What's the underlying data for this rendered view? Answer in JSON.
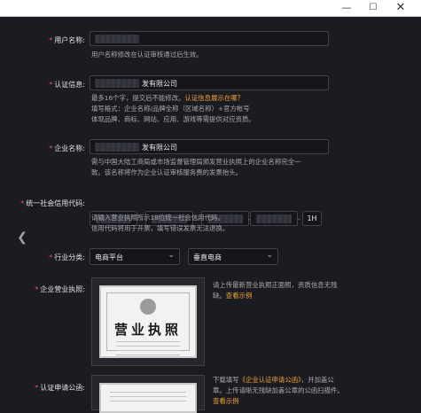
{
  "window": {
    "minimize_icon": "minimize-icon",
    "maximize_icon": "maximize-icon",
    "close_icon": "close-icon"
  },
  "form": {
    "username": {
      "label": "用户名称:",
      "hint": "用户名称修改在认证审核通过后生效。"
    },
    "cert_info": {
      "label": "认证信息:",
      "value_suffix": "发有限公司",
      "hint_line1": "最多16个字，提交后不能修改。",
      "hint_link": "认证信息展示在哪？",
      "hint_line2": "填写格式：企业名称/品牌全称（区域名称）+官方帐号",
      "hint_line3": "体现品牌、商标、网站、应用、游戏等需提供对应资质。"
    },
    "company_name": {
      "label": "企业名称:",
      "value_suffix": "发有限公司",
      "hint_line1": "需与中国大陆工商局或市场监督管理局颁发营业执照上的企业名称完全一",
      "hint_line2": "致。该名称将作为企业认证审核服务费的发票抬头。"
    },
    "credit_code": {
      "label": "统一社会信用代码:",
      "last_value": "1H",
      "separator": "-",
      "hint_line1": "请输入营业执照所示18位统一社会信用代码。",
      "hint_line2": "信用代码将用于开票，填写错误发票无法退换。"
    },
    "industry": {
      "label": "行业分类:",
      "primary": "电商平台",
      "secondary": "垂直电商"
    },
    "license": {
      "label": "企业营业执照:",
      "image_title": "营业执照",
      "hint_line1": "请上传最新营业执照正面照，资质信息无残",
      "hint_line2": "缺。",
      "hint_link": "查看示例"
    },
    "application": {
      "label": "认证申请公函:",
      "hint_prefix": "下载填写",
      "hint_link1": "《企业认证申请公函》",
      "hint_suffix": "，并加盖公",
      "hint_line2": "章。上传请晰无残缺加盖公章的公函扫描件。",
      "hint_link2": "查看示例"
    }
  },
  "colors": {
    "background": "#1b1c22",
    "accent_link": "#f0a23c",
    "required_mark": "#ff4d4f"
  }
}
